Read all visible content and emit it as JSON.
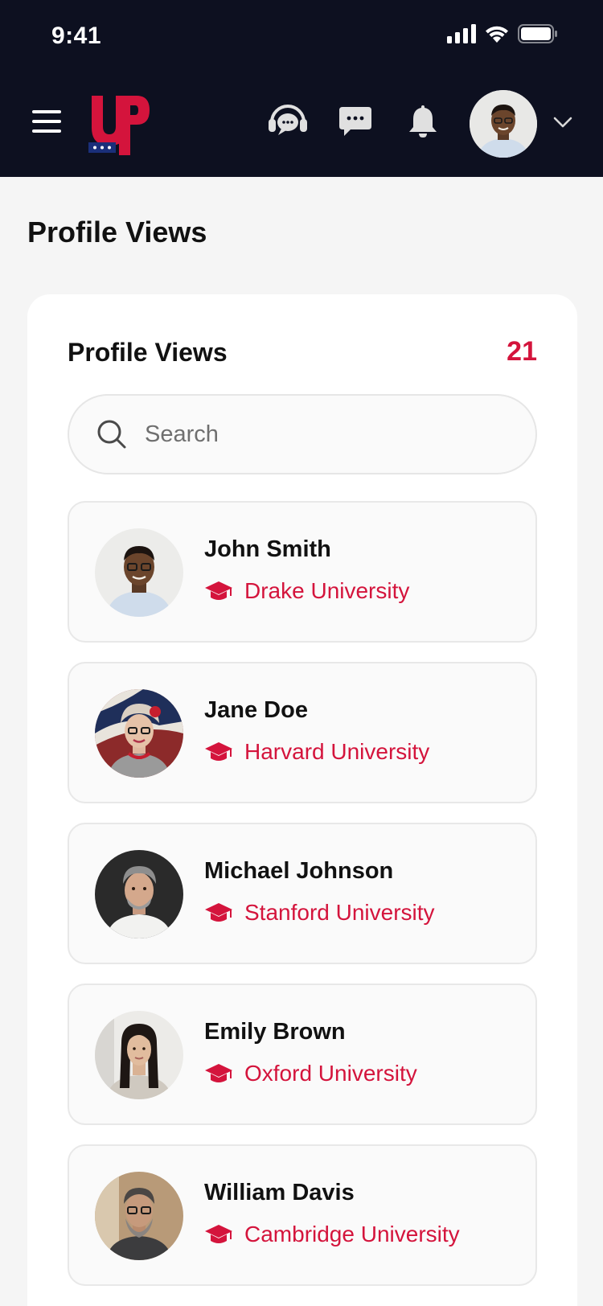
{
  "status_bar": {
    "time": "9:41"
  },
  "header": {
    "logo_text": "UP",
    "icons": [
      "menu-icon",
      "support-headset-icon",
      "chat-bubble-icon",
      "bell-icon",
      "chevron-down-icon"
    ]
  },
  "page": {
    "title": "Profile Views"
  },
  "card": {
    "title": "Profile Views",
    "count": "21",
    "search": {
      "placeholder": "Search"
    },
    "viewers": [
      {
        "name": "John Smith",
        "university": "Drake University"
      },
      {
        "name": "Jane Doe",
        "university": "Harvard University"
      },
      {
        "name": "Michael Johnson",
        "university": "Stanford University"
      },
      {
        "name": "Emily Brown",
        "university": "Oxford University"
      },
      {
        "name": "William Davis",
        "university": "Cambridge University"
      }
    ]
  },
  "colors": {
    "header_bg": "#0d1020",
    "accent": "#d4143c",
    "page_bg": "#f5f5f5",
    "card_bg": "#ffffff"
  }
}
